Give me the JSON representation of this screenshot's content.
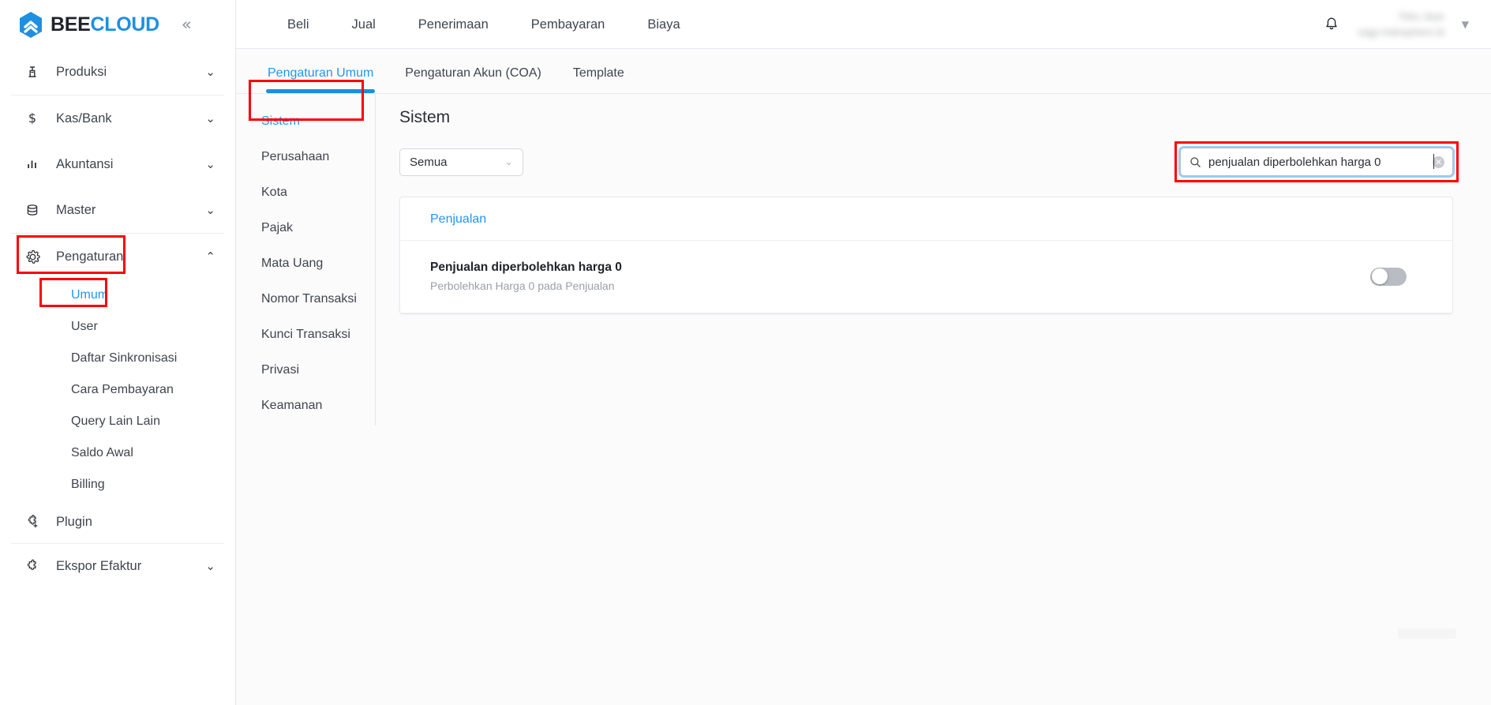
{
  "brand": {
    "name_part1": "BEE",
    "name_part2": "CLOUD",
    "collapse_icon": "double-chevron-left",
    "accent": "#1e8fe1"
  },
  "sidebar": {
    "items": [
      {
        "label": "Produksi",
        "icon": "factory-icon",
        "chevron": "⌄",
        "expanded": false
      },
      {
        "label": "Kas/Bank",
        "icon": "dollar-icon",
        "chevron": "⌄",
        "expanded": false
      },
      {
        "label": "Akuntansi",
        "icon": "bar-chart-icon",
        "chevron": "⌄",
        "expanded": false
      },
      {
        "label": "Master",
        "icon": "database-icon",
        "chevron": "⌄",
        "expanded": false
      },
      {
        "label": "Pengaturan",
        "icon": "gear-icon",
        "chevron": "⌃",
        "expanded": true
      },
      {
        "label": "Plugin",
        "icon": "puzzle-plus-icon",
        "chevron": "",
        "expanded": false
      },
      {
        "label": "Ekspor Efaktur",
        "icon": "puzzle-icon",
        "chevron": "⌄",
        "expanded": false
      }
    ],
    "pengaturan_sub": [
      {
        "label": "Umum",
        "active": true
      },
      {
        "label": "User",
        "active": false
      },
      {
        "label": "Daftar Sinkronisasi",
        "active": false
      },
      {
        "label": "Cara Pembayaran",
        "active": false
      },
      {
        "label": "Query Lain Lain",
        "active": false
      },
      {
        "label": "Saldo Awal",
        "active": false
      },
      {
        "label": "Billing",
        "active": false
      }
    ]
  },
  "topbar": {
    "nav": [
      "Beli",
      "Jual",
      "Penerimaan",
      "Pembayaran",
      "Biaya"
    ],
    "bell_icon": "bell-icon",
    "user_line1": "Toko Jaya",
    "user_line2": "sagy-indosphere.id",
    "caret_icon": "caret-down-icon"
  },
  "tabs": [
    {
      "label": "Pengaturan Umum",
      "active": true
    },
    {
      "label": "Pengaturan Akun (COA)",
      "active": false
    },
    {
      "label": "Template",
      "active": false
    }
  ],
  "subnav": [
    {
      "label": "Sistem",
      "active": true
    },
    {
      "label": "Perusahaan",
      "active": false
    },
    {
      "label": "Kota",
      "active": false
    },
    {
      "label": "Pajak",
      "active": false
    },
    {
      "label": "Mata Uang",
      "active": false
    },
    {
      "label": "Nomor Transaksi",
      "active": false
    },
    {
      "label": "Kunci Transaksi",
      "active": false
    },
    {
      "label": "Privasi",
      "active": false
    },
    {
      "label": "Keamanan",
      "active": false
    }
  ],
  "panel": {
    "title": "Sistem",
    "filter_select": {
      "value": "Semua",
      "chevron_icon": "chevron-down-icon"
    },
    "search": {
      "value": "penjualan diperbolehkan harga 0",
      "placeholder": "",
      "icon": "search-icon",
      "clear_icon": "clear-circle-icon",
      "clear_glyph": "✕"
    },
    "card": {
      "group_title": "Penjualan",
      "rows": [
        {
          "name": "Penjualan diperbolehkan harga 0",
          "description": "Perbolehkan Harga 0 pada Penjualan",
          "toggle_state": "off"
        }
      ]
    }
  }
}
